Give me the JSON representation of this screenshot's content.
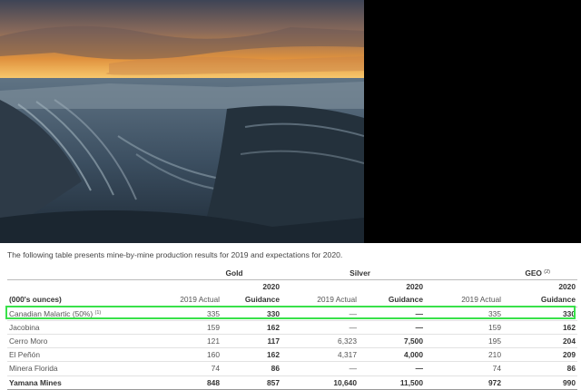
{
  "intro": "The following table presents mine-by-mine production results for 2019 and expectations for 2020.",
  "table": {
    "groups": {
      "gold": "Gold",
      "silver": "Silver",
      "geo": "GEO",
      "geo_note": "(2)"
    },
    "year_2020": "2020",
    "unit_label": "(000's ounces)",
    "col_actual": "2019 Actual",
    "col_guidance": "Guidance",
    "rows": [
      {
        "name": "Canadian Malartic (50%)",
        "note": "(1)",
        "gold_actual": "335",
        "gold_guidance": "330",
        "silver_actual": "—",
        "silver_guidance": "—",
        "geo_actual": "335",
        "geo_guidance": "330"
      },
      {
        "name": "Jacobina",
        "note": "",
        "gold_actual": "159",
        "gold_guidance": "162",
        "silver_actual": "—",
        "silver_guidance": "—",
        "geo_actual": "159",
        "geo_guidance": "162"
      },
      {
        "name": "Cerro Moro",
        "note": "",
        "gold_actual": "121",
        "gold_guidance": "117",
        "silver_actual": "6,323",
        "silver_guidance": "7,500",
        "geo_actual": "195",
        "geo_guidance": "204"
      },
      {
        "name": "El Peñón",
        "note": "",
        "gold_actual": "160",
        "gold_guidance": "162",
        "silver_actual": "4,317",
        "silver_guidance": "4,000",
        "geo_actual": "210",
        "geo_guidance": "209"
      },
      {
        "name": "Minera Florida",
        "note": "",
        "gold_actual": "74",
        "gold_guidance": "86",
        "silver_actual": "—",
        "silver_guidance": "—",
        "geo_actual": "74",
        "geo_guidance": "86"
      }
    ],
    "total": {
      "name": "Yamana Mines",
      "gold_actual": "848",
      "gold_guidance": "857",
      "silver_actual": "10,640",
      "silver_guidance": "11,500",
      "geo_actual": "972",
      "geo_guidance": "990"
    }
  },
  "colors": {
    "highlight": "#39e14a"
  }
}
